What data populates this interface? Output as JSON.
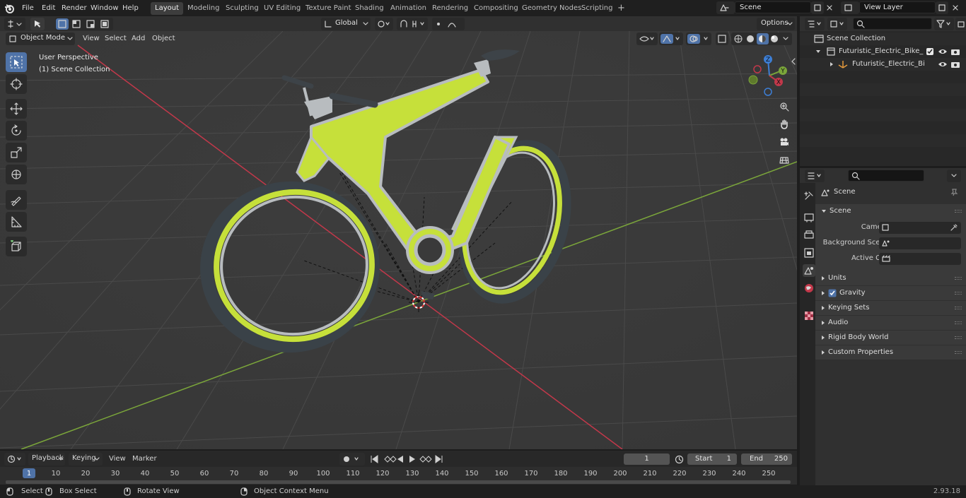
{
  "topbar": {
    "menu": [
      "File",
      "Edit",
      "Render",
      "Window",
      "Help"
    ],
    "workspaces": [
      "Layout",
      "Modeling",
      "Sculpting",
      "UV Editing",
      "Texture Paint",
      "Shading",
      "Animation",
      "Rendering",
      "Compositing",
      "Geometry Nodes",
      "Scripting"
    ],
    "active_workspace": "Layout",
    "add_tab": "+",
    "scene_name": "Scene",
    "view_layer": "View Layer"
  },
  "viewport_header": {
    "transform_orientation": "Global",
    "mode": "Object Mode",
    "menus": [
      "View",
      "Select",
      "Add",
      "Object"
    ],
    "options_label": "Options"
  },
  "viewport": {
    "perspective_label": "User Perspective",
    "collection_label": "(1) Scene Collection",
    "gizmo_axes": {
      "z": "Z",
      "y": "Y",
      "x": "X"
    }
  },
  "outliner": {
    "root": "Scene Collection",
    "items": [
      {
        "label": "Futuristic_Electric_Bike_Green"
      },
      {
        "label": "Futuristic_Electric_Bike_G"
      }
    ]
  },
  "properties": {
    "breadcrumb": "Scene",
    "panel_title": "Scene",
    "fields": [
      {
        "label": "Camera"
      },
      {
        "label": "Background Scene"
      },
      {
        "label": "Active Clip"
      }
    ],
    "sections": [
      "Units",
      "Gravity",
      "Keying Sets",
      "Audio",
      "Rigid Body World",
      "Custom Properties"
    ],
    "gravity_checked": true
  },
  "timeline": {
    "menus": [
      "Playback",
      "Keying",
      "View",
      "Marker"
    ],
    "current_frame": "1",
    "start_label": "Start",
    "start_value": "1",
    "end_label": "End",
    "end_value": "250",
    "ruler": [
      "1",
      "10",
      "20",
      "30",
      "40",
      "50",
      "60",
      "70",
      "80",
      "90",
      "100",
      "110",
      "120",
      "130",
      "140",
      "150",
      "160",
      "170",
      "180",
      "190",
      "200",
      "210",
      "220",
      "230",
      "240",
      "250"
    ]
  },
  "statusbar": {
    "select": "Select",
    "box_select": "Box Select",
    "rotate_view": "Rotate View",
    "context_menu": "Object Context Menu",
    "version": "2.93.18"
  },
  "colors": {
    "accent": "#4f73a8",
    "bike_green": "#c6e03a",
    "x_axis": "#c2384a",
    "y_axis": "#7ba63a",
    "z_axis": "#3d7fd6"
  }
}
